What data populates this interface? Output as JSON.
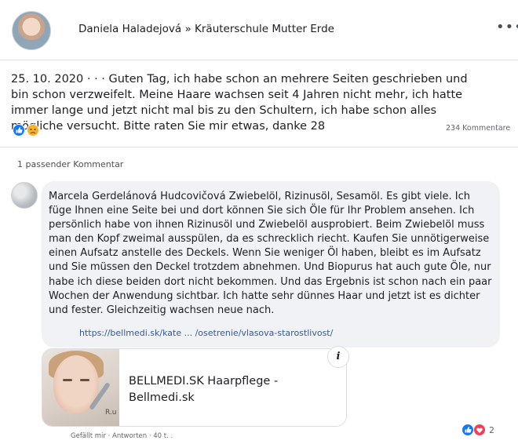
{
  "post": {
    "author": "Daniela Haladejová » Kräuterschule Mutter Erde",
    "text": "25. 10. 2020 · · · Guten Tag, ich habe schon an mehrere Seiten geschrieben und bin schon verzweifelt. Meine Haare wachsen seit 4 Jahren nicht mehr, ich hatte immer lange und jetzt nicht mal bis zu den Schultern, ich habe schon alles mögliche versucht. Bitte raten Sie mir etwas, danke 28",
    "comment_count": "234 Kommentare",
    "more_icon": "more-dots-icon",
    "reactions": [
      "like-icon",
      "sad-icon"
    ]
  },
  "comments_section": {
    "match_label": "1 passender Kommentar"
  },
  "comment": {
    "text": "Marcela Gerdelánová Hudcovičová Zwiebelöl, Rizinusöl, Sesamöl. Es gibt viele. Ich füge Ihnen eine Seite bei und dort können Sie sich Öle für Ihr Problem ansehen. Ich persönlich habe von ihnen Rizinusöl und Zwiebelöl ausprobiert. Beim Zwiebelöl muss man den Kopf zweimal ausspülen, da es schrecklich riecht. Kaufen Sie unnötigerweise einen Aufsatz anstelle des Deckels. Wenn Sie weniger Öl haben, bleibt es im Aufsatz und Sie müssen den Deckel trotzdem abnehmen. Und Biopurus hat auch gute Öle, nur habe ich diese beiden dort nicht bekommen. Und das Ergebnis ist schon nach ein paar Wochen der Anwendung sichtbar. Ich hatte sehr dünnes Haar und jetzt ist es dichter und fester. Gleichzeitig wachsen neue nach.",
    "link": "https://bellmedi.sk/kate ... /osetrenie/vlasova-starostlivost/",
    "card": {
      "title": "BELLMEDI.SK Haarpflege - Bellmedi.sk",
      "thumb_text": "R.u"
    },
    "meta": "Gefällt mir · Antworten · 40 t. .",
    "reactions": [
      "like-icon",
      "love-icon"
    ],
    "reaction_count": "2",
    "colors": {
      "like": "#1877f2",
      "love": "#f33e58",
      "sad": "#f7b125"
    }
  }
}
